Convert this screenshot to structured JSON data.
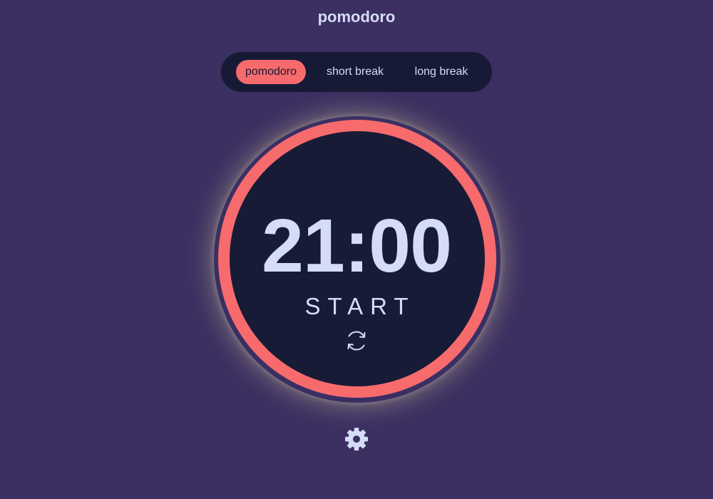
{
  "app": {
    "title": "pomodoro"
  },
  "modes": {
    "active": "pomodoro",
    "tabs": [
      {
        "label": "pomodoro"
      },
      {
        "label": "short break"
      },
      {
        "label": "long break"
      }
    ]
  },
  "timer": {
    "display": "21:00",
    "action_label": "START",
    "progress": 1.0
  },
  "icons": {
    "reset": "refresh-icon",
    "settings": "gear-icon"
  },
  "colors": {
    "background": "#3c2f61",
    "panel": "#171a35",
    "accent": "#f76b6d",
    "text": "#d5dcf8"
  }
}
